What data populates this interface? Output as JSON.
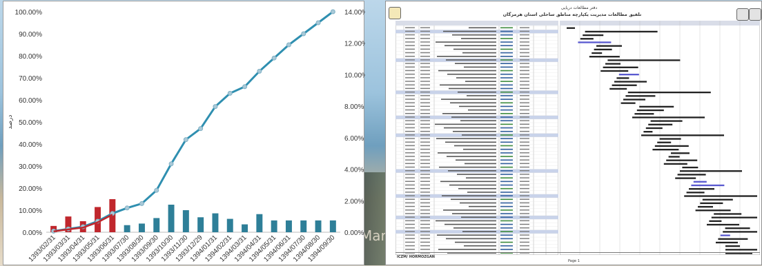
{
  "chart_data": {
    "type": "bar+line",
    "categories": [
      "1393/02/31",
      "1393/03/31",
      "1393/04/31",
      "1393/05/31",
      "1393/06/31",
      "1393/07/30",
      "1393/08/30",
      "1393/09/30",
      "1393/10/30",
      "1393/11/30",
      "1393/12/29",
      "1394/01/31",
      "1394/02/31",
      "1394/03/31",
      "1394/04/31",
      "1394/05/31",
      "1394/06/31",
      "1394/07/30",
      "1394/08/30",
      "1394/09/30"
    ],
    "ylabel": "درصد",
    "left_axis": {
      "ticks": [
        "0.00%",
        "10.00%",
        "20.00%",
        "30.00%",
        "40.00%",
        "50.00%",
        "60.00%",
        "70.00%",
        "80.00%",
        "90.00%",
        "100.00%"
      ],
      "ylim": [
        0,
        100
      ]
    },
    "right_axis": {
      "ticks": [
        "0.00%",
        "2.00%",
        "4.00%",
        "6.00%",
        "8.00%",
        "10.00%",
        "12.00%",
        "14.00%"
      ],
      "ylim": [
        0,
        14
      ]
    },
    "series": [
      {
        "axis": "right",
        "kind": "bar",
        "colors": [
          "#c0272d",
          "#c0272d",
          "#c0272d",
          "#c0272d",
          "#c0272d",
          "#2e7f98",
          "#2e7f98",
          "#2e7f98",
          "#2e7f98",
          "#2e7f98",
          "#2e7f98",
          "#2e7f98",
          "#2e7f98",
          "#2e7f98",
          "#2e7f98",
          "#2e7f98",
          "#2e7f98",
          "#2e7f98",
          "#2e7f98",
          "#2e7f98"
        ],
        "values": [
          0.4,
          1.0,
          0.7,
          1.6,
          2.1,
          0.45,
          0.55,
          0.9,
          1.75,
          1.4,
          0.95,
          1.2,
          0.85,
          0.5,
          1.15,
          0.75,
          0.75,
          0.75,
          0.75,
          0.75
        ]
      },
      {
        "axis": "left",
        "kind": "line",
        "color": "#2f8fb0",
        "marker": "#a9c9d8",
        "values": [
          0.5,
          1.5,
          2.5,
          5.0,
          8.5,
          11.0,
          13.0,
          19.0,
          31.0,
          42.0,
          47.0,
          57.0,
          63.0,
          66.0,
          73.0,
          79.0,
          85.0,
          90.0,
          95.0,
          100.0
        ]
      },
      {
        "axis": "left",
        "kind": "line",
        "color": "#c0272d",
        "values": [
          0.4,
          1.3,
          2.1,
          4.5,
          8.0
        ]
      }
    ],
    "grid": false
  },
  "gantt": {
    "title_line1": "دفتر مطالعات دریایی",
    "title_line2": "تلفیق مطالعات مدیریت یکپارچه مناطق ساحلی استان هرمزگان",
    "footer_label": "ICZM/ HORMOZGAN",
    "page_label": "Page 1",
    "rows": 64
  },
  "background": {
    "photo_text": "Mar"
  }
}
